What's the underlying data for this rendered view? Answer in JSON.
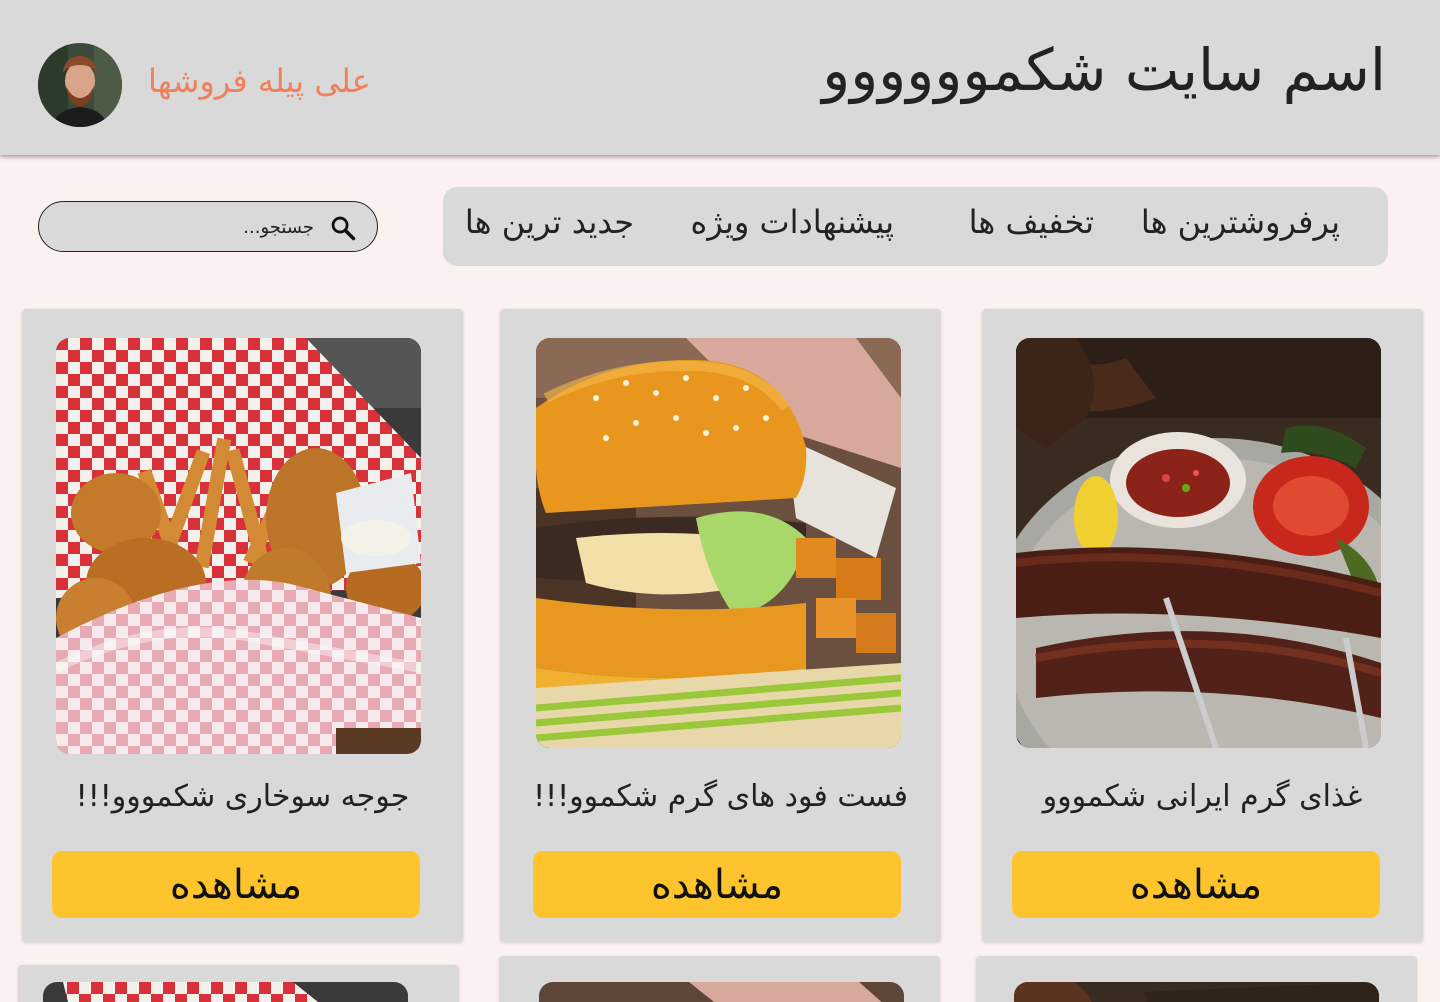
{
  "header": {
    "site_title": "اسم سایت شکموووووو",
    "user_name": "علی پیله فروشها"
  },
  "nav": {
    "items": [
      {
        "label": "پرفروشترین ها"
      },
      {
        "label": "تخفیف ها"
      },
      {
        "label": "پیشنهادات ویژه"
      },
      {
        "label": "جدید ترین ها"
      }
    ]
  },
  "search": {
    "placeholder": "جستجو..."
  },
  "cards": [
    {
      "title": "غذای گرم ایرانی شکمووو",
      "button": "مشاهده"
    },
    {
      "title": "فست فود های گرم شکموو!!!",
      "button": "مشاهده"
    },
    {
      "title": "جوجه سوخاری شکمووو!!!",
      "button": "مشاهده"
    }
  ],
  "colors": {
    "header_bg": "#d9d9d9",
    "page_bg": "#fcf1f1",
    "accent_button": "#fec42d",
    "user_name": "#f0805a"
  }
}
